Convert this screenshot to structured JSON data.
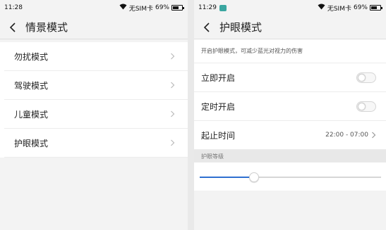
{
  "left_screen": {
    "status_bar": {
      "time": "11:28",
      "carrier": "无SIM卡",
      "battery": "69%",
      "battery_level": 0.69
    },
    "header": {
      "title": "情景模式"
    },
    "menu_items": [
      {
        "label": "勿扰模式"
      },
      {
        "label": "驾驶模式"
      },
      {
        "label": "儿童模式"
      },
      {
        "label": "护眼模式"
      }
    ]
  },
  "right_screen": {
    "status_bar": {
      "time": "11:29",
      "carrier": "无SIM卡",
      "battery": "69%",
      "battery_level": 0.69
    },
    "header": {
      "title": "护眼模式"
    },
    "description": "开启护眼模式，可减少蓝光对视力的伤害",
    "settings": {
      "enable_now": {
        "label": "立即开启",
        "on": false
      },
      "scheduled": {
        "label": "定时开启",
        "on": false
      },
      "time_range": {
        "label": "起止时间",
        "value": "22:00 - 07:00"
      }
    },
    "eye_level": {
      "label": "护眼等级",
      "level": 0.3
    }
  },
  "colors": {
    "accent": "#2e6fd0",
    "notification_badge": "#3aa6a0"
  },
  "icons": {
    "back": "back-arrow-icon",
    "chevron": "chevron-right-icon",
    "wifi": "wifi-icon",
    "battery": "battery-icon",
    "notification": "notification-badge-icon"
  }
}
